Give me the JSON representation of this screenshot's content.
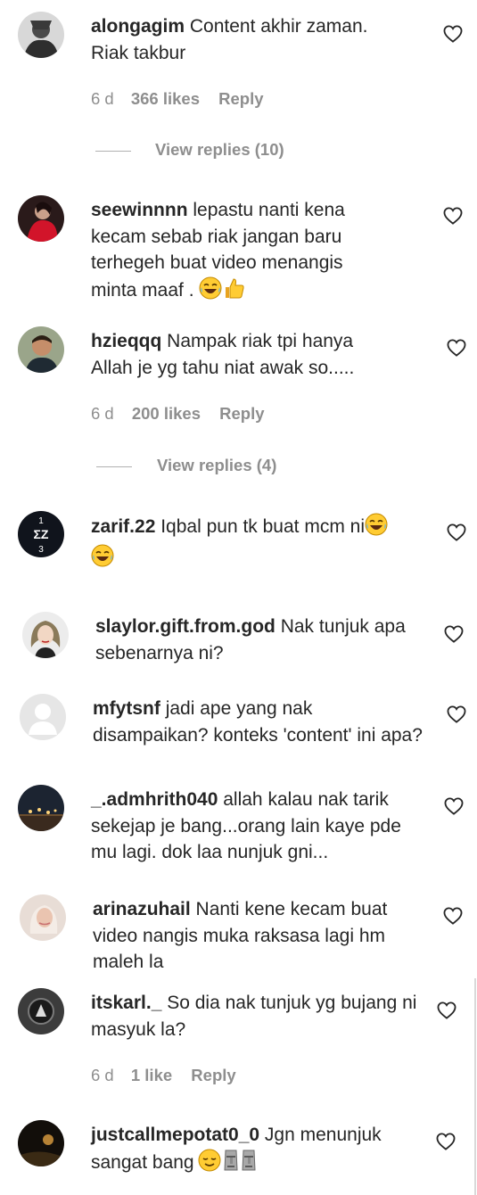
{
  "comments": [
    {
      "username": "alongagim",
      "text": "Content akhir zaman.\nRiak takbur",
      "age": "6 d",
      "likes": "366 likes",
      "reply": "Reply",
      "view_replies": "View replies (10)"
    },
    {
      "username": "seewinnnn",
      "text": "lepastu nanti kena kecam sebab riak jangan baru terhegeh buat video menangis minta maaf ."
    },
    {
      "username": "hzieqqq",
      "text": "Nampak riak tpi hanya Allah je yg tahu niat awak so.....",
      "age": "6 d",
      "likes": "200 likes",
      "reply": "Reply",
      "view_replies": "View replies (4)"
    },
    {
      "username": "zarif.22",
      "text": "Iqbal pun tk buat mcm ni",
      "avatar_text": "1 ΣZ 3"
    },
    {
      "username": "slaylor.gift.from.god",
      "text": "Nak tunjuk apa sebenarnya ni?"
    },
    {
      "username": "mfytsnf",
      "text": "jadi ape yang nak disampaikan? konteks 'content' ini apa?"
    },
    {
      "username": "_.admhrith040",
      "text": "allah kalau nak tarik sekejap je bang...orang lain kaye pde mu lagi. dok laa nunjuk gni..."
    },
    {
      "username": "arinazuhail",
      "text": "Nanti kene kecam buat video nangis muka raksasa lagi hm maleh la"
    },
    {
      "username": "itskarl._",
      "text": "So dia nak tunjuk yg bujang ni masyuk la?",
      "age": "6 d",
      "likes": "1 like",
      "reply": "Reply"
    },
    {
      "username": "justcallmepotat0_0",
      "text": "Jgn menunjuk sangat bang"
    }
  ],
  "icons": {
    "like": "heart-outline-icon",
    "emoji_laugh": "face-with-tears-of-joy-icon",
    "emoji_thumbs": "thumbs-up-icon",
    "emoji_relieved": "relieved-face-icon",
    "emoji_moai": "moai-icon"
  },
  "colors": {
    "text": "#262626",
    "meta": "#8e8e8e",
    "background": "#ffffff"
  }
}
